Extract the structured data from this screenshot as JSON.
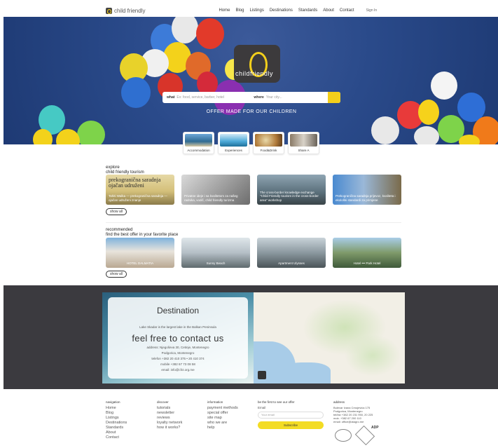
{
  "header": {
    "logo_text": "child friendly",
    "nav": [
      "Home",
      "Blog",
      "Listings",
      "Destinations",
      "Standards",
      "About",
      "Contact"
    ],
    "signin": "Sign In"
  },
  "hero": {
    "brand": "childfriendly",
    "search_what_label": "what",
    "search_what_placeholder": "Ex: food, service, barber, hotel",
    "search_where_label": "where",
    "search_where_placeholder": "Your city...",
    "tagline": "OFFER MADE FOR OUR CHILDREN"
  },
  "categories": [
    "Accommodation",
    "Experiences",
    "Food&Drink",
    "Share A"
  ],
  "explore": {
    "title_line1": "explore",
    "title_line2": "child friendly tourism",
    "cards": [
      {
        "headline": "prekogranična saradnja ojačan udruženi",
        "caption": "Tahiti Walka — prekogranična saradnja — ojačan udruženi znanje"
      },
      {
        "headline": "",
        "caption": "Privatne ideje i sa kvalitetom za našeg radnika, vodič, child friendly turizma"
      },
      {
        "headline": "",
        "caption": "The cross-border knowledge exchange \"Child Friendly tourism in the cross-border area\" workshop"
      },
      {
        "headline": "",
        "caption": "Prekogranična saradnja prijevoz, kvaliteta i ekološki standardi za primjene"
      }
    ],
    "show_all": "show all"
  },
  "recommended": {
    "title_line1": "recommended",
    "title_line2": "find the best offer in your favorite place",
    "cards": [
      "HOTEL DALMATIA",
      "Sunny Beach",
      "Apartment Ulysses",
      "Hotel ••• Park Hotel"
    ],
    "show_all": "show all"
  },
  "destination": {
    "title": "Destination",
    "intro": "Lake Skadar is the largest lake in the Balkan Peninsula",
    "contact_title": "feel free to contact us",
    "address": "address: Njegoševa 30, Cetinje, Montenegro",
    "city": "Podgorica, Montenegro",
    "phone": "telefon +382 20 410 375 • 20 410 374",
    "mobile": "mobile +382 67 73 08 58",
    "email": "email: info@cfct.org.me"
  },
  "footer": {
    "navigation": {
      "title": "navigation",
      "items": [
        "Home",
        "Blog",
        "Listings",
        "Destinations",
        "Standards",
        "About",
        "Contact"
      ]
    },
    "discover": {
      "title": "discover",
      "items": [
        "tutorials",
        "newsletter",
        "reviews",
        "loyalty network",
        "how it works?"
      ]
    },
    "information": {
      "title": "information",
      "items": [
        "payment methods",
        "special offer",
        "site map",
        "who we are",
        "help"
      ]
    },
    "newsletter": {
      "title": "be the first to see our offer",
      "email_label": "Email",
      "email_placeholder": "Your email",
      "subscribe": "Subscribe"
    },
    "address": {
      "title": "address",
      "lines": [
        "Bulevar Ivana Crnojevića 175",
        "Podgorica, Montenegro",
        "tel/fax +382 20 231 950, 20 225",
        "mob. +382 67 200 110",
        "email: office@atagro.me"
      ]
    },
    "badges": [
      "ADP"
    ]
  },
  "colors": {
    "accent": "#f3cf1b",
    "dark_band": "#3b3a3f",
    "hero_bg": "#2a4a8a"
  }
}
